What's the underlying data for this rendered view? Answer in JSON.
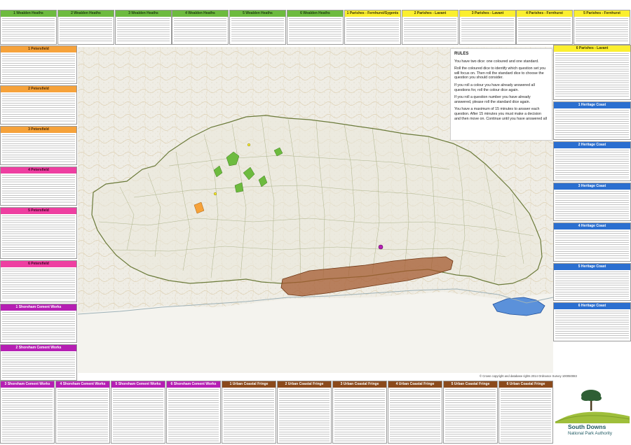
{
  "cards": {
    "top": [
      {
        "title": "1 Wealden Heaths",
        "color": "green"
      },
      {
        "title": "2 Wealden Heaths",
        "color": "green"
      },
      {
        "title": "3 Wealden Heaths",
        "color": "green"
      },
      {
        "title": "4 Wealden Heaths",
        "color": "green"
      },
      {
        "title": "5 Wealden Heaths",
        "color": "green"
      },
      {
        "title": "6 Wealden Heaths",
        "color": "green"
      },
      {
        "title": "1 Parishes - Fernhurst/Sygents",
        "color": "yellow"
      },
      {
        "title": "2 Parishes - Lavant",
        "color": "yellow"
      },
      {
        "title": "3 Parishes - Lavant",
        "color": "yellow"
      },
      {
        "title": "4 Parishes - Fernhurst",
        "color": "yellow"
      },
      {
        "title": "5 Parishes - Fernhurst",
        "color": "yellow"
      }
    ],
    "left": [
      {
        "title": "1 Petersfield",
        "color": "orange"
      },
      {
        "title": "2 Petersfield",
        "color": "orange"
      },
      {
        "title": "3 Petersfield",
        "color": "orange"
      },
      {
        "title": "4 Petersfield",
        "color": "pink"
      },
      {
        "title": "5 Petersfield",
        "color": "pink"
      },
      {
        "title": "6 Petersfield",
        "color": "pink"
      },
      {
        "title": "1 Shoreham Cement Works",
        "color": "purple"
      },
      {
        "title": "2 Shoreham Cement Works",
        "color": "purple"
      }
    ],
    "right": [
      {
        "title": "6 Parishes - Lavant",
        "color": "yellow"
      },
      {
        "title": "1 Heritage Coast",
        "color": "blue"
      },
      {
        "title": "2 Heritage Coast",
        "color": "blue"
      },
      {
        "title": "3 Heritage Coast",
        "color": "blue"
      },
      {
        "title": "4 Heritage Coast",
        "color": "blue"
      },
      {
        "title": "5 Heritage Coast",
        "color": "blue"
      },
      {
        "title": "6 Heritage Coast",
        "color": "blue"
      }
    ],
    "bottom": [
      {
        "title": "3 Shoreham Cement Works",
        "color": "purple"
      },
      {
        "title": "4 Shoreham Cement Works",
        "color": "purple"
      },
      {
        "title": "5 Shoreham Cement Works",
        "color": "purple"
      },
      {
        "title": "6 Shoreham Cement Works",
        "color": "purple"
      },
      {
        "title": "1 Urban Coastal Fringe",
        "color": "brown"
      },
      {
        "title": "2 Urban Coastal Fringe",
        "color": "brown"
      },
      {
        "title": "3 Urban Coastal Fringe",
        "color": "brown"
      },
      {
        "title": "4 Urban Coastal Fringe",
        "color": "brown"
      },
      {
        "title": "5 Urban Coastal Fringe",
        "color": "brown"
      },
      {
        "title": "6 Urban Coastal Fringe",
        "color": "brown"
      }
    ]
  },
  "colors": {
    "green": "#6dbb3f",
    "yellow": "#fbef2f",
    "orange": "#f6a23a",
    "pink": "#ee3fa1",
    "blue": "#2b6fd0",
    "purple": "#b51fb3",
    "brown": "#8b4a1c",
    "boundary": "#6b7a3a",
    "urban_area": "#a45a2f",
    "heritage_area": "#3f7fd6"
  },
  "rules": {
    "title": "RULES",
    "paragraphs": [
      "You have two dice: one coloured and one standard.",
      "Roll the coloured dice to identify which question set you will focus on. Then roll the standard dice to choose the question you should consider.",
      "If you roll a colour you have already answered all questions for, roll the colour dice again.",
      "If you roll a question number you have already answered, please roll the standard dice again.",
      "You have a maximum of 15 minutes to answer each question. After 15 minutes you must make a decision and then move on. Continue until you have answered all"
    ]
  },
  "copyright": "© Crown copyright and database rights 2014 Ordnance Survey 100050083",
  "logo": {
    "line1": "South Downs",
    "line2": "National Park Authority",
    "icon": "tree-on-hill-icon"
  }
}
